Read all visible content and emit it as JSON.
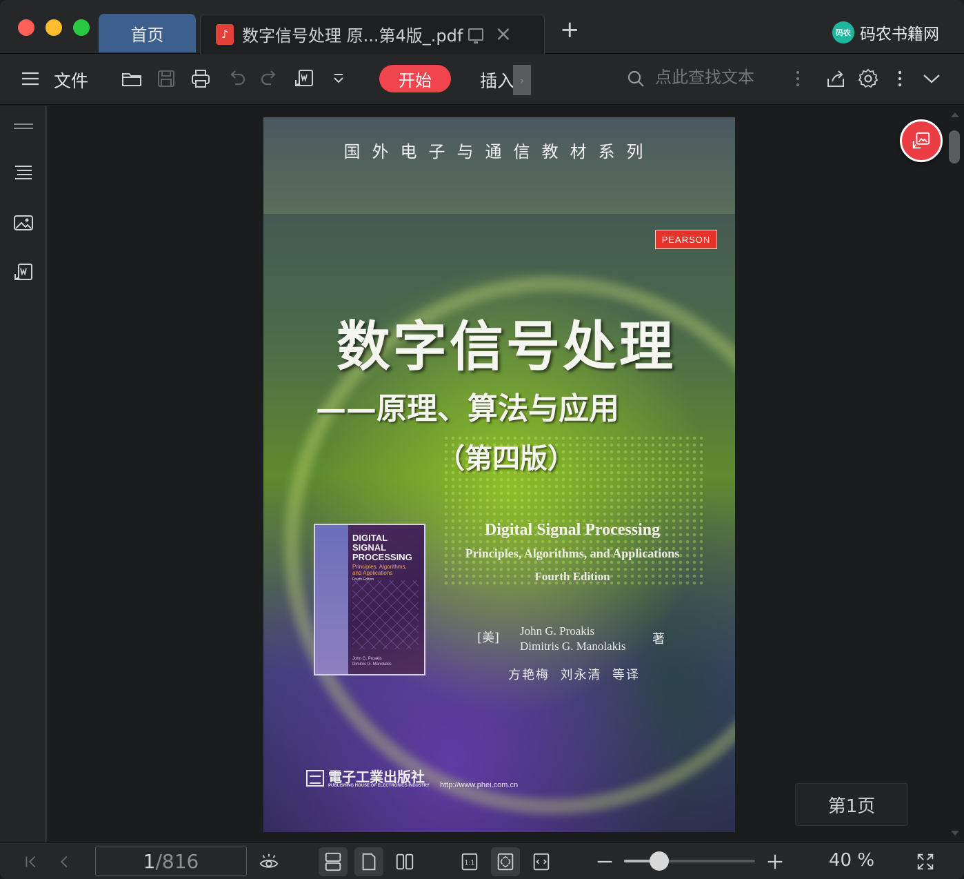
{
  "window": {
    "tabs": [
      {
        "label": "首页",
        "active": false
      },
      {
        "label": "数字信号处理 原...第4版_.pdf",
        "active": true
      }
    ],
    "brand": "码农书籍网",
    "brand_logo_text": "码农"
  },
  "toolbar": {
    "menu_label": "文件",
    "start_label": "开始",
    "insert_label": "插入",
    "search_placeholder": "点此查找文本",
    "accent_color": "#f0454d"
  },
  "document": {
    "series_title": "国外电子与通信教材系列",
    "pearson": "PEARSON",
    "cn_title": "数字信号处理",
    "cn_subtitle": "——原理、算法与应用",
    "cn_edition": "（第四版）",
    "en_title": "Digital Signal Processing",
    "en_subtitle": "Principles, Algorithms, and Applications",
    "en_edition": "Fourth Edition",
    "mini_cover": {
      "title": "DIGITAL\nSIGNAL\nPROCESSING",
      "subtitle": "Principles, Algorithms,\nand Applications",
      "edition": "Fourth Edition",
      "authors": "John G. Proakis\nDimitris G. Manolakis"
    },
    "origin": "[美]",
    "authors": "John G. Proakis\nDimitris G. Manolakis",
    "author_mark": "著",
    "translators": "方艳梅  刘永清  等译",
    "publisher": "電子工業出版社",
    "publisher_en": "PUBLISHING HOUSE OF ELECTRONICS INDUSTRY",
    "url": "http://www.phei.com.cn"
  },
  "page_badge": "第1页",
  "navigation": {
    "current_page": "1",
    "total_pages": "/816"
  },
  "zoom": {
    "label": "40 %",
    "slider_fraction": 0.27
  },
  "icons": [
    "hamburger-icon",
    "open-folder-icon",
    "save-icon",
    "print-icon",
    "undo-icon",
    "redo-icon",
    "convert-icon",
    "dropdown-icon",
    "search-icon",
    "more-icon",
    "share-icon",
    "settings-icon",
    "collapse-icon",
    "thumbnail-panel-icon",
    "outline-icon",
    "image-icon",
    "convert-word-icon",
    "first-page-icon",
    "prev-page-icon",
    "eye-icon",
    "continuous-view-icon",
    "single-page-icon",
    "two-page-icon",
    "actual-size-icon",
    "fit-page-icon",
    "fit-width-icon",
    "zoom-out-icon",
    "zoom-in-icon",
    "fullscreen-icon",
    "pdf-file-icon",
    "monitor-icon",
    "close-icon",
    "add-tab-icon",
    "extract-image-icon"
  ]
}
